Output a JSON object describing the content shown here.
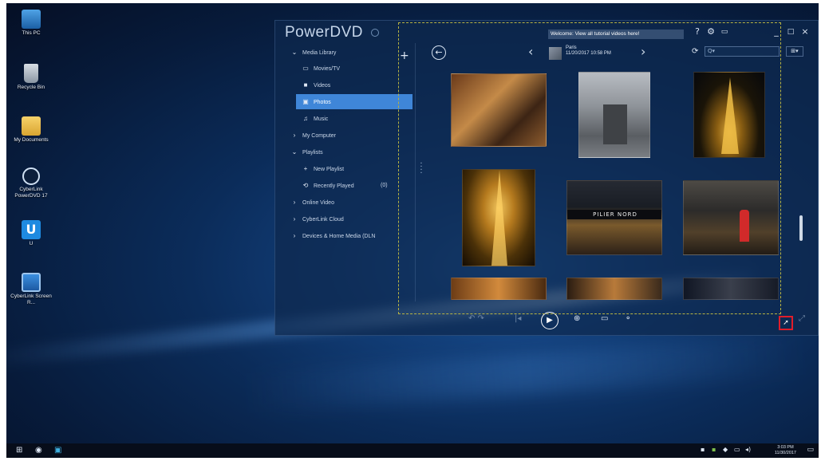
{
  "desktop": {
    "icons": [
      {
        "label": "This PC",
        "icon": "computer-icon"
      },
      {
        "label": "Recycle Bin",
        "icon": "recycle-bin-icon"
      },
      {
        "label": "My Documents",
        "icon": "folder-icon"
      },
      {
        "label": "CyberLink PowerDVD 17",
        "icon": "powerdvd-icon"
      },
      {
        "label": "U",
        "icon": "u-app-icon"
      },
      {
        "label": "CyberLink Screen R...",
        "icon": "screen-recorder-icon"
      }
    ]
  },
  "app": {
    "brand": "PowerDVD",
    "welcome_banner": "Welcome: View all tutorial videos here!",
    "window_buttons": [
      "?",
      "⚙",
      "▭",
      "_",
      "□",
      "×"
    ],
    "current_title": "Paris",
    "current_date": "11/20/2017 10:58 PM",
    "search_placeholder": "Q▾",
    "view_button": "⊞▾"
  },
  "sidebar": {
    "items": [
      {
        "label": "Media Library",
        "icon": "chevron-down-icon"
      },
      {
        "label": "Movies/TV",
        "icon": "tv-icon"
      },
      {
        "label": "Videos",
        "icon": "video-icon"
      },
      {
        "label": "Photos",
        "icon": "photo-icon",
        "selected": true
      },
      {
        "label": "Music",
        "icon": "music-icon"
      },
      {
        "label": "My Computer",
        "icon": "chevron-right-icon"
      },
      {
        "label": "Playlists",
        "icon": "chevron-down-icon"
      },
      {
        "label": "New Playlist",
        "icon": "plus-icon"
      },
      {
        "label": "Recently Played",
        "icon": "recent-icon",
        "count": "(0)"
      },
      {
        "label": "Online Video",
        "icon": "chevron-right-icon"
      },
      {
        "label": "CyberLink Cloud",
        "icon": "chevron-right-icon"
      },
      {
        "label": "Devices & Home Media (DLN",
        "icon": "chevron-right-icon"
      }
    ]
  },
  "photos": [
    {
      "name": "cafe-interior"
    },
    {
      "name": "stone-building"
    },
    {
      "name": "eiffel-tower-night"
    },
    {
      "name": "eiffel-tower-closeup"
    },
    {
      "name": "metro-pilier-nord"
    },
    {
      "name": "woman-red-jacket"
    },
    {
      "name": "partial-warm"
    },
    {
      "name": "partial-lights"
    },
    {
      "name": "partial-dark"
    }
  ],
  "metro_sign": "PILIER NORD",
  "taskbar": {
    "clock_time": "3:03 PM",
    "clock_date": "11/30/2017"
  },
  "colors": {
    "selection": "#3f86d8",
    "highlight_box": "#e11d2a",
    "dashed_guide": "#b7b342"
  }
}
